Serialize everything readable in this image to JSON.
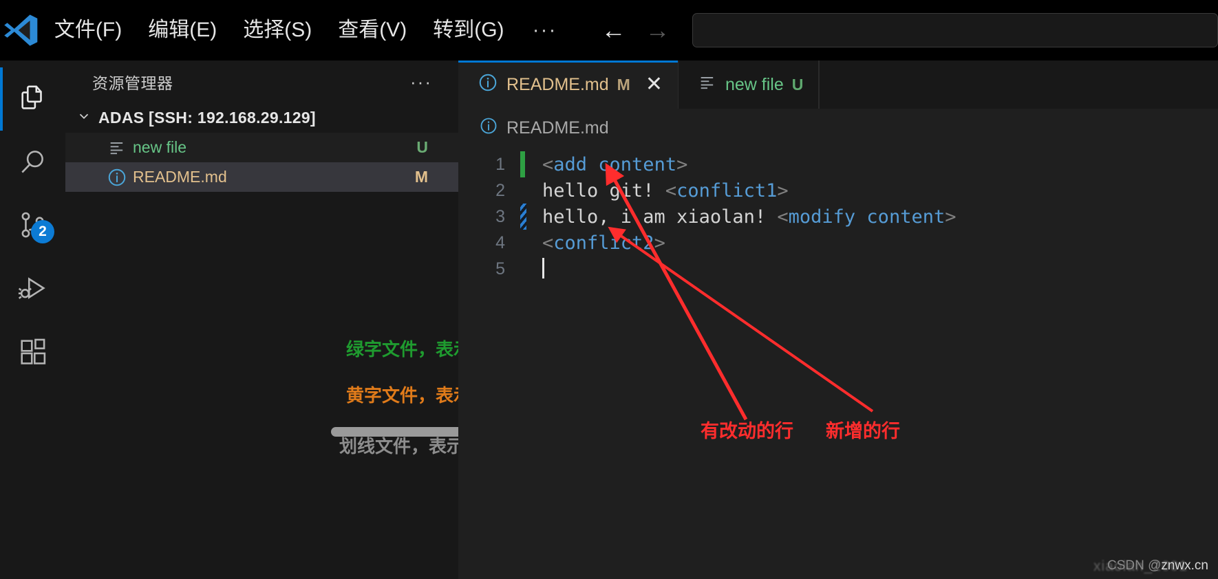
{
  "titlebar": {
    "logo_icon": "vscode-logo-icon",
    "menu": [
      {
        "label": "文件(F)",
        "name": "menu-file"
      },
      {
        "label": "编辑(E)",
        "name": "menu-edit"
      },
      {
        "label": "选择(S)",
        "name": "menu-selection"
      },
      {
        "label": "查看(V)",
        "name": "menu-view"
      },
      {
        "label": "转到(G)",
        "name": "menu-go"
      }
    ],
    "more_label": "···",
    "back_arrow": "←",
    "forward_arrow": "→",
    "search_placeholder": ""
  },
  "activitybar": {
    "items": [
      {
        "icon": "explorer-files-icon",
        "active": true,
        "badge": ""
      },
      {
        "icon": "search-icon",
        "active": false,
        "badge": ""
      },
      {
        "icon": "source-control-branch-icon",
        "active": false,
        "badge": "2"
      },
      {
        "icon": "run-and-debug-icon",
        "active": false,
        "badge": ""
      },
      {
        "icon": "extensions-blocks-icon",
        "active": false,
        "badge": ""
      }
    ]
  },
  "sidebar": {
    "title": "资源管理器",
    "more_label": "···",
    "chevron_down": "⌄",
    "root": {
      "label": "ADAS [SSH: 192.168.29.129]",
      "expanded": true
    },
    "files": [
      {
        "name": "new file",
        "color": "green",
        "badge": "U",
        "badge_color": "green",
        "icon": "text-lines-file-icon",
        "state": "hover"
      },
      {
        "name": "README.md",
        "color": "orange",
        "badge": "M",
        "badge_color": "orange",
        "icon": "info-circle-file-icon",
        "state": "selected"
      }
    ],
    "annotations": [
      {
        "text": "绿字文件，表示新增",
        "color": "#1f9b2f",
        "name": "annotation-green-added"
      },
      {
        "text": "黄字文件，表示修改",
        "color": "#e07b1a",
        "name": "annotation-yellow-modified"
      },
      {
        "text": "划线文件，表示删除",
        "color": "#a8a8a8",
        "name": "annotation-strike-deleted"
      }
    ]
  },
  "editor": {
    "tabs": [
      {
        "label": "README.md",
        "mark": "M",
        "color": "orange",
        "icon": "info-circle-file-icon",
        "active": true,
        "close_icon": "✕"
      },
      {
        "label": "new file",
        "mark": "U",
        "color": "green",
        "icon": "text-lines-file-icon",
        "active": false,
        "close_icon": ""
      }
    ],
    "breadcrumb": {
      "icon": "info-circle-file-icon",
      "label": "README.md"
    },
    "lines": [
      {
        "number": "1",
        "gutter": "added",
        "tokens": [
          {
            "t": "<",
            "c": "tag"
          },
          {
            "t": "add",
            "c": "blue"
          },
          {
            "t": " content",
            "c": "blue"
          },
          {
            "t": ">",
            "c": "tag"
          }
        ]
      },
      {
        "number": "2",
        "gutter": "none",
        "tokens": [
          {
            "t": "hello git! ",
            "c": "plain"
          },
          {
            "t": "<",
            "c": "tag"
          },
          {
            "t": "conflict1",
            "c": "blue"
          },
          {
            "t": ">",
            "c": "tag"
          }
        ]
      },
      {
        "number": "3",
        "gutter": "modified",
        "tokens": [
          {
            "t": "hello, i am xiaolan! ",
            "c": "plain"
          },
          {
            "t": "<",
            "c": "tag"
          },
          {
            "t": "modify content",
            "c": "blue"
          },
          {
            "t": ">",
            "c": "tag"
          }
        ]
      },
      {
        "number": "4",
        "gutter": "none",
        "tokens": [
          {
            "t": "<",
            "c": "tag"
          },
          {
            "t": "conflict2",
            "c": "blue"
          },
          {
            "t": ">",
            "c": "tag"
          }
        ]
      },
      {
        "number": "5",
        "gutter": "none",
        "tokens": []
      }
    ]
  },
  "overlay_labels": [
    {
      "text": "有改动的行",
      "name": "arrow-label-modified-line"
    },
    {
      "text": "新增的行",
      "name": "arrow-label-added-line"
    }
  ],
  "watermark": {
    "csdn_prefix": "CSDN @",
    "csdn_user": "xiaolan_2001",
    "brand": "znwx.cn"
  },
  "colors": {
    "accent": "#0078d4",
    "added_green": "#2ea043",
    "modified_blue": "#2a7fd4",
    "file_green": "#67c587",
    "file_orange": "#e2c08d",
    "arrow_red": "#ff2d2d"
  }
}
